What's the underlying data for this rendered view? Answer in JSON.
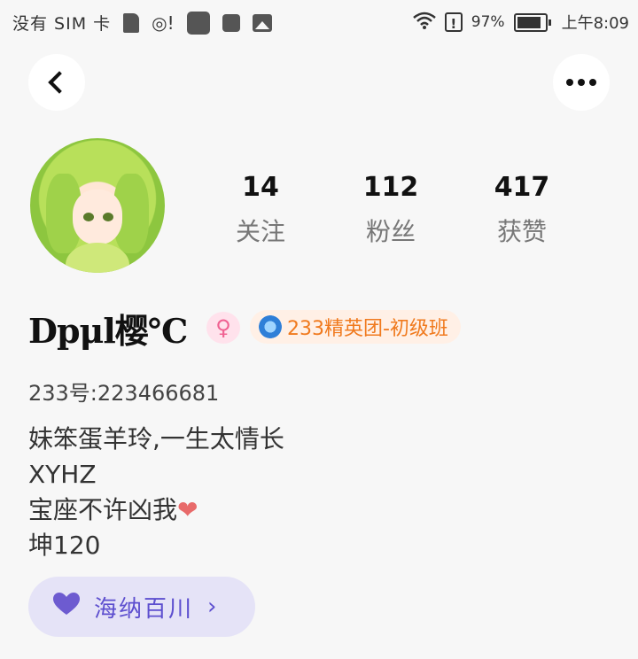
{
  "status_bar": {
    "carrier": "没有 SIM 卡",
    "battery_percent": "97%",
    "time": "上午8:09",
    "icons": [
      "sim-card-icon",
      "hotspot-icon",
      "app-icon",
      "app-icon",
      "image-icon",
      "wifi-icon",
      "alert-icon",
      "battery-icon"
    ]
  },
  "header": {
    "back_icon": "back-chevron-icon",
    "more_icon": "more-dots-icon"
  },
  "profile": {
    "stats": [
      {
        "value": "14",
        "label": "关注"
      },
      {
        "value": "112",
        "label": "粉丝"
      },
      {
        "value": "417",
        "label": "获赞"
      }
    ],
    "name": "Dpμl樱℃",
    "gender_symbol": "♀",
    "rank_badge": "233精英团-初级班",
    "uid": "233号:223466681",
    "bio_lines": [
      "妹笨蛋羊玲,一生太情长",
      "XYHZ",
      "宝座不许凶我",
      "坤120"
    ],
    "bio_heart": "❤",
    "tag_chip": {
      "icon": "heart-icon",
      "label": "海纳百川",
      "arrow": "›"
    }
  },
  "colors": {
    "background": "#f7f7f7",
    "chip_bg": "#e5e3f7",
    "chip_text": "#5d4fcf",
    "rank_bg": "#fff0e6",
    "rank_text": "#f07a1e",
    "gender_pink": "#f06292"
  }
}
